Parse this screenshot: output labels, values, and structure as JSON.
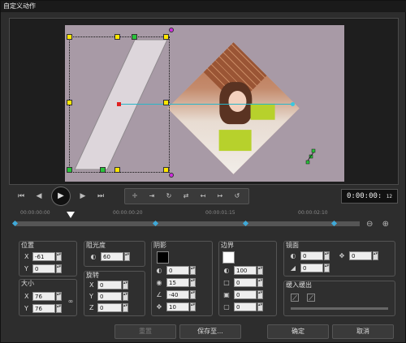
{
  "window": {
    "title": "自定义动作"
  },
  "timecode": {
    "main": "0:00:00:",
    "frames": "12"
  },
  "ruler": {
    "ticks": [
      "00:00:00:00",
      "00:00:00:20",
      "00:00:01:15",
      "00:00:02:10"
    ]
  },
  "position": {
    "title": "位置",
    "x_label": "X",
    "x_value": "-61",
    "y_label": "Y",
    "y_value": "0"
  },
  "size": {
    "title": "大小",
    "x_label": "X",
    "x_value": "76",
    "y_label": "Y",
    "y_value": "76"
  },
  "opacity": {
    "title": "阻光度",
    "value": "60"
  },
  "rotation": {
    "title": "旋转",
    "x_label": "X",
    "x_value": "0",
    "y_label": "Y",
    "y_value": "0",
    "z_label": "Z",
    "z_value": "0"
  },
  "shadow": {
    "title": "阴影",
    "color": "#000000",
    "v1": "0",
    "v2": "15",
    "v3": "-40",
    "v4": "10"
  },
  "border": {
    "title": "边界",
    "color": "#ffffff",
    "v1": "100",
    "v2": "0",
    "v3": "0",
    "v4": "0"
  },
  "mirror": {
    "title": "镜面",
    "v1": "0",
    "v2": "0",
    "v3": "0"
  },
  "ease": {
    "title": "缓入缓出"
  },
  "buttons": {
    "reset": "重置",
    "save_to": "保存至...",
    "ok": "确定",
    "cancel": "取消"
  },
  "colors": {
    "handle": "#ffe600",
    "handle_green": "#28c33a",
    "handle_magenta": "#d12de0",
    "canvas": "#a89aa6",
    "keyframe": "#3fa9d8"
  }
}
